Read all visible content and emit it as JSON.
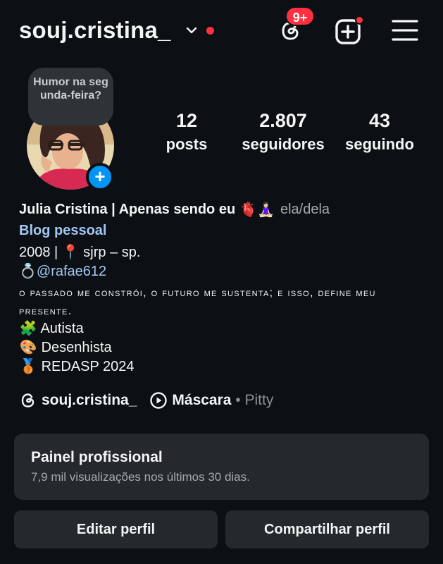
{
  "header": {
    "username": "souj.cristina_",
    "notification_badge": "9+",
    "icons": [
      "chevron-down-icon",
      "threads-icon",
      "add-post-icon",
      "menu-icon"
    ],
    "accent_red": "#ff3040"
  },
  "note": {
    "text": "Humor na segunda-feira?"
  },
  "profile": {
    "stats": [
      {
        "value": "12",
        "label": "posts"
      },
      {
        "value": "2.807",
        "label": "seguidores"
      },
      {
        "value": "43",
        "label": "seguindo"
      }
    ]
  },
  "bio": {
    "name": "Julia Cristina | Apenas sendo eu",
    "name_emojis": "🫀🧘🏻‍♀️",
    "pronouns": "ela/dela",
    "category": "Blog pessoal",
    "location_prefix": "2008 | ",
    "location_pin": "📍",
    "location": " sjrp – sp.",
    "ring_emoji": "💍",
    "mention": "@rafae612",
    "quote": "O PASSADO ME CONSTRÓI, O FUTURO ME SUSTENTA; E ISSO, DEFINE MEU PRESENTE.",
    "lines": [
      {
        "emoji": "🧩",
        "text": "Autista"
      },
      {
        "emoji": "🎨",
        "text": "Desenhista"
      },
      {
        "emoji": "🥉",
        "text": "REDASP 2024"
      }
    ]
  },
  "links": {
    "threads_handle": "souj.cristina_",
    "song": "Máscara",
    "separator": " • ",
    "artist": "Pitty"
  },
  "panel": {
    "title": "Painel profissional",
    "subtitle": "7,9 mil visualizações nos últimos 30 dias."
  },
  "buttons": {
    "edit": "Editar perfil",
    "share": "Compartilhar perfil"
  },
  "colors": {
    "background": "#0c1014",
    "surface": "#25292e",
    "link": "#a3c7f3",
    "blue": "#0095f6"
  }
}
